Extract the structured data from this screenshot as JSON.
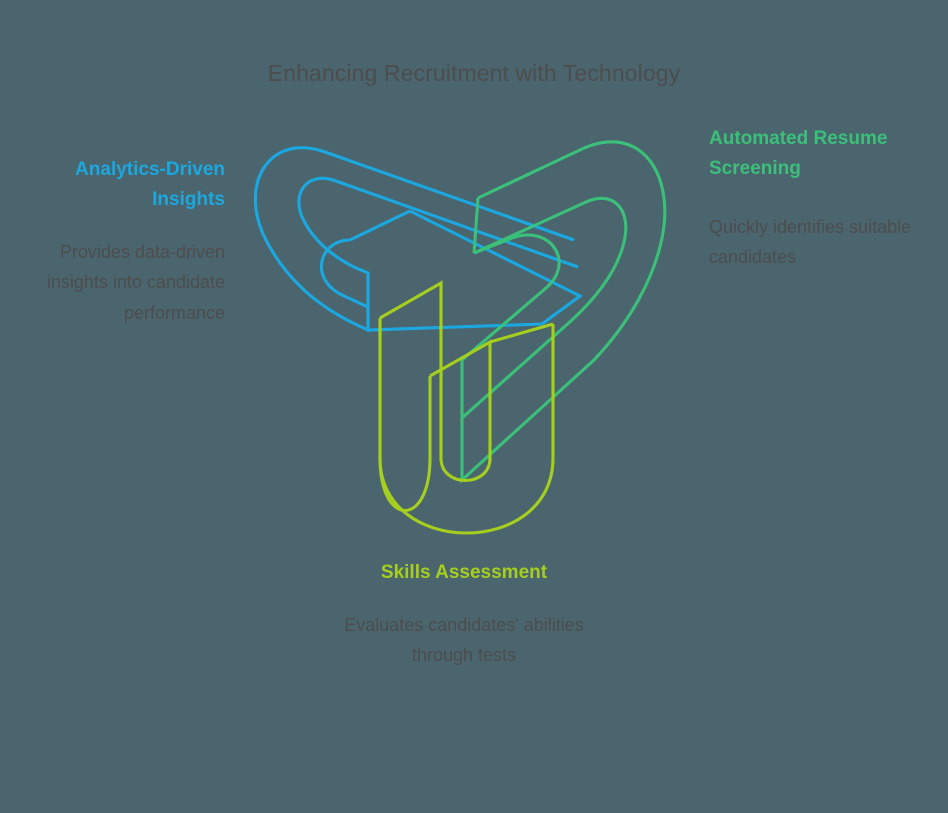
{
  "diagram": {
    "title": "Enhancing Recruitment with Technology",
    "type": "trefoil-knot-three-node",
    "background_color": "#4a656e",
    "body_text_color": "#4d4d4d",
    "center_graphic": {
      "name": "interlocking-trefoil-knot",
      "arms": [
        {
          "name": "analytics-arm",
          "color": "#1ba8e0",
          "orientation": "upper-left"
        },
        {
          "name": "screening-arm",
          "color": "#3bc07a",
          "orientation": "upper-right"
        },
        {
          "name": "skills-arm",
          "color": "#a6ce1e",
          "orientation": "bottom"
        }
      ]
    },
    "nodes": [
      {
        "id": "analytics",
        "heading": "Analytics-Driven Insights",
        "description": "Provides data-driven insights into candidate performance",
        "color": "#1ba8e0",
        "position": "left"
      },
      {
        "id": "screening",
        "heading": "Automated Resume Screening",
        "description": "Quickly identifies suitable candidates",
        "color": "#3bc07a",
        "position": "right"
      },
      {
        "id": "skills",
        "heading": "Skills Assessment",
        "description": "Evaluates candidates' abilities through tests",
        "color": "#a6ce1e",
        "position": "bottom"
      }
    ]
  },
  "chart_data": {
    "type": "diagram",
    "title": "Enhancing Recruitment with Technology",
    "categories": [
      "Analytics-Driven Insights",
      "Automated Resume Screening",
      "Skills Assessment"
    ],
    "annotations": [
      "Provides data-driven insights into candidate performance",
      "Quickly identifies suitable candidates",
      "Evaluates candidates' abilities through tests"
    ],
    "colors": [
      "#1ba8e0",
      "#3bc07a",
      "#a6ce1e"
    ],
    "legend": "none",
    "grid": false
  }
}
